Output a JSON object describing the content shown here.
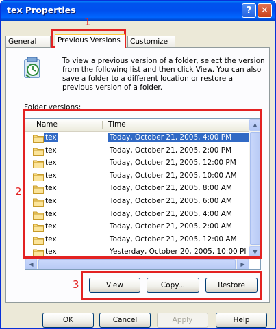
{
  "window": {
    "title": "tex Properties",
    "help_glyph": "?",
    "close_glyph": "✕"
  },
  "tabs": [
    {
      "label": "General",
      "active": false
    },
    {
      "label": "Previous Versions",
      "active": true
    },
    {
      "label": "Customize",
      "active": false
    }
  ],
  "description": "To view a previous version of a folder, select the version from the following list and then click View. You can also save a folder to a different location or restore a previous version of a folder.",
  "folder_versions_label": "Folder versions:",
  "list": {
    "columns": {
      "name": "Name",
      "time": "Time"
    },
    "rows": [
      {
        "name": "tex",
        "time": "Today, October 21, 2005, 4:00 PM",
        "selected": true
      },
      {
        "name": "tex",
        "time": "Today, October 21, 2005, 2:00 PM"
      },
      {
        "name": "tex",
        "time": "Today, October 21, 2005, 12:00 PM"
      },
      {
        "name": "tex",
        "time": "Today, October 21, 2005, 10:00 AM"
      },
      {
        "name": "tex",
        "time": "Today, October 21, 2005, 8:00 AM"
      },
      {
        "name": "tex",
        "time": "Today, October 21, 2005, 6:00 AM"
      },
      {
        "name": "tex",
        "time": "Today, October 21, 2005, 4:00 AM"
      },
      {
        "name": "tex",
        "time": "Today, October 21, 2005, 2:00 AM"
      },
      {
        "name": "tex",
        "time": "Today, October 21, 2005, 12:00 AM"
      },
      {
        "name": "tex",
        "time": "Yesterday, October 20, 2005, 10:00 PI"
      }
    ]
  },
  "actions": {
    "view": "View",
    "copy": "Copy...",
    "restore": "Restore"
  },
  "footer": {
    "ok": "OK",
    "cancel": "Cancel",
    "apply": "Apply",
    "help": "Help"
  },
  "callouts": {
    "one": "1",
    "two": "2",
    "three": "3"
  },
  "colors": {
    "accent_red": "#e32222",
    "selection": "#316ac5",
    "titlebar": "#0053ee"
  }
}
